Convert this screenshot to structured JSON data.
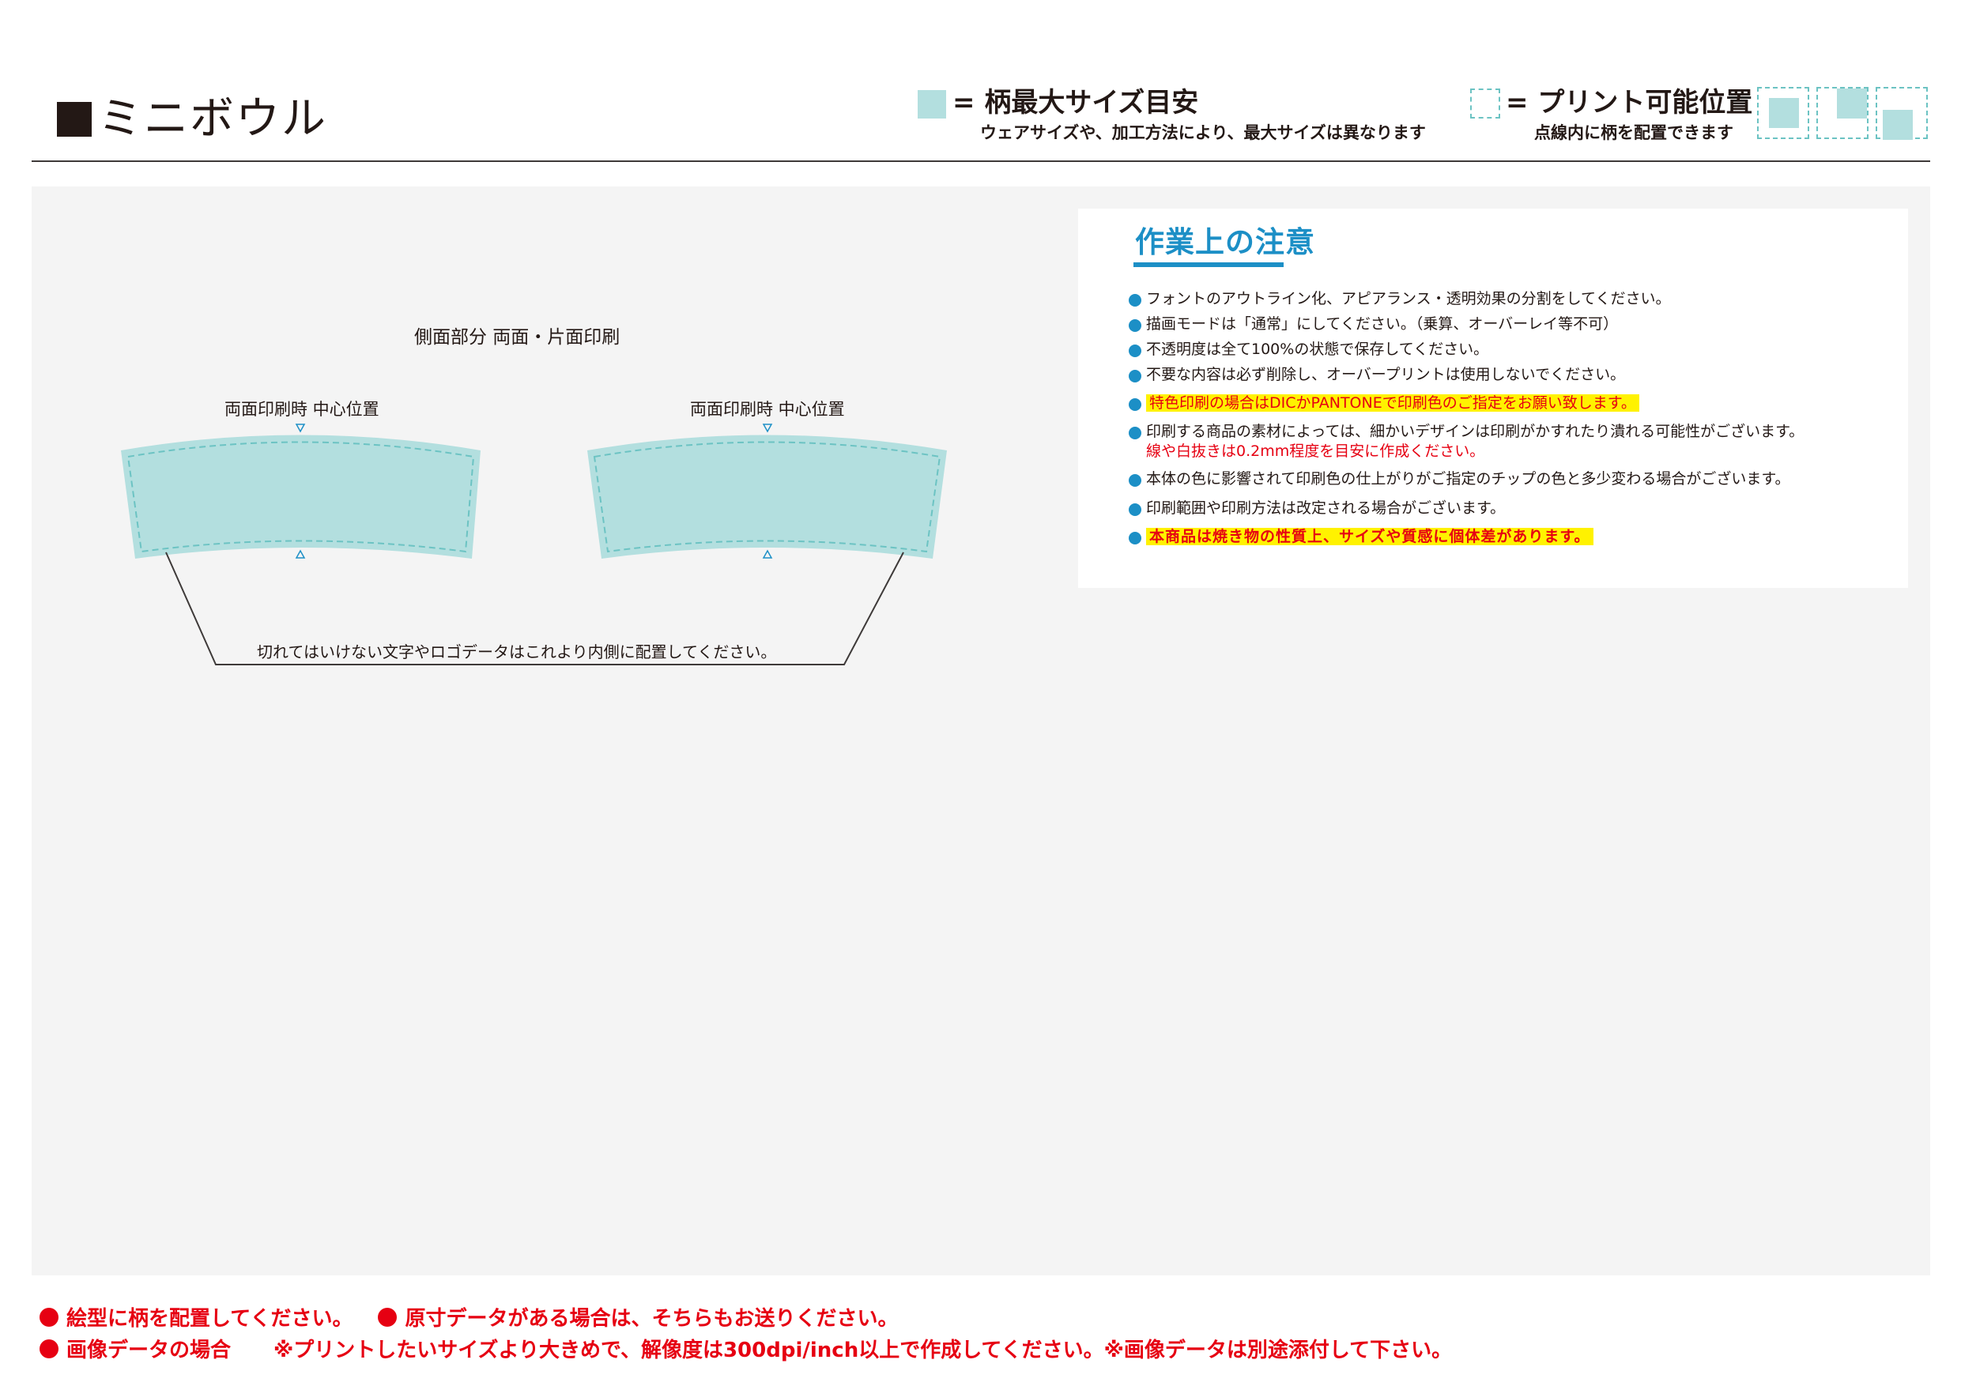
{
  "header": {
    "title": "ミニボウル",
    "legend_pattern": {
      "title": "= 柄最大サイズ目安",
      "note": "ウェアサイズや、加工方法により、最大サイズは異なります"
    },
    "legend_print": {
      "title": "= プリント可能位置",
      "note": "点線内に柄を配置できます"
    }
  },
  "diagram": {
    "section_label": "側面部分 両面・片面印刷",
    "left_center_label": "両面印刷時 中心位置",
    "right_center_label": "両面印刷時 中心位置",
    "inner_note": "切れてはいけない文字やロゴデータはこれより内側に配置してください。"
  },
  "notice": {
    "heading": "作業上の注意",
    "items": [
      "フォントのアウトライン化、アピアランス・透明効果の分割をしてください。",
      "描画モードは「通常」にしてください。（乗算、オーバーレイ等不可）",
      "不透明度は全て100%の状態で保存してください。",
      "不要な内容は必ず削除し、オーバープリントは使用しないでください。",
      "特色印刷の場合はDICかPANTONEで印刷色のご指定をお願い致します。",
      "印刷する商品の素材によっては、細かいデザインは印刷がかすれたり潰れる可能性がございます。",
      "本体の色に影響されて印刷色の仕上がりがご指定のチップの色と多少変わる場合がございます。",
      "印刷範囲や印刷方法は改定される場合がございます。",
      "本商品は焼き物の性質上、サイズや質感に個体差があります。"
    ],
    "item6_sub": "線や白抜きは0.2mm程度を目安に作成ください。"
  },
  "footer": {
    "line1_a": "絵型に柄を配置してください。",
    "line1_b": "原寸データがある場合は、そちらもお送りください。",
    "line2_a": "画像データの場合",
    "line2_b": "※プリントしたいサイズより大きめで、解像度は300dpi/inch以上で作成してください。※画像データは別途添付して下さい。"
  },
  "colors": {
    "pattern_fill": "#b3dfdf",
    "print_dash": "#6cc3c3",
    "accent_blue": "#1c8fc6",
    "warning_red": "#e60012",
    "highlight_yellow": "#fff200"
  }
}
